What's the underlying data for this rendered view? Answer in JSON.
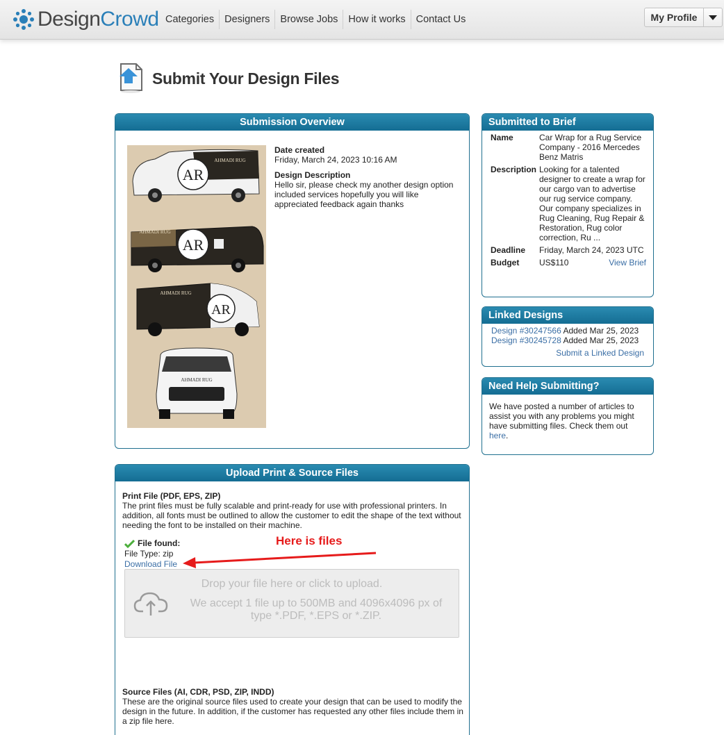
{
  "header": {
    "logo_design": "Design",
    "logo_crowd": "Crowd",
    "nav": [
      {
        "label": "Categories"
      },
      {
        "label": "Designers"
      },
      {
        "label": "Browse Jobs"
      },
      {
        "label": "How it works"
      },
      {
        "label": "Contact Us"
      }
    ],
    "profile_label": "My Profile"
  },
  "page": {
    "title": "Submit Your Design Files"
  },
  "overview": {
    "heading": "Submission Overview",
    "date_created_label": "Date created",
    "date_created_value": "Friday, March 24, 2023 10:16 AM",
    "description_label": "Design Description",
    "description_value": "Hello sir, please check my another design option included services hopefully you will like appreciated feedback again thanks",
    "van_brand": "AHMADI RUG"
  },
  "brief": {
    "heading": "Submitted to Brief",
    "name_label": "Name",
    "name_value": "Car Wrap for a Rug Service Company - 2016 Mercedes Benz Matris",
    "description_label": "Description",
    "description_value": "Looking for a talented designer to create a wrap for our cargo van to advertise our rug service company. Our company specializes in Rug Cleaning, Rug Repair & Restoration, Rug color correction, Ru ...",
    "deadline_label": "Deadline",
    "deadline_value": "Friday, March 24, 2023 UTC",
    "budget_label": "Budget",
    "budget_value": "US$110",
    "view_brief": "View Brief"
  },
  "linked": {
    "heading": "Linked Designs",
    "items": [
      {
        "link": "Design #30247566",
        "added": "Added Mar 25, 2023"
      },
      {
        "link": "Design #30245728",
        "added": "Added Mar 25, 2023"
      }
    ],
    "submit_link": "Submit a Linked Design"
  },
  "help": {
    "heading": "Need Help Submitting?",
    "text": "We have posted a number of articles to assist you with any problems you might have submitting files. Check them out",
    "link": "here",
    "period": "."
  },
  "upload": {
    "heading": "Upload Print & Source Files",
    "print_title": "Print File (PDF, EPS, ZIP)",
    "print_text": "The print files must be fully scalable and print-ready for use with professional printers. In addition, all fonts must be outlined to allow the customer to edit the shape of the text without needing the font to be installed on their machine.",
    "file_found": "File found:",
    "file_type": "File Type: zip",
    "download": "Download File",
    "annotation": "Here is files",
    "drop_line1": "Drop your file here or click to upload.",
    "drop_line2": "We accept 1 file up to 500MB and 4096x4096 px of type *.PDF, *.EPS or *.ZIP.",
    "source_title": "Source Files (AI, CDR, PSD, ZIP, INDD)",
    "source_text": "These are the original source files used to create your design that can be used to modify the design in the future. In addition, if the customer has requested any other files include them in a zip file here."
  },
  "colors": {
    "brand_blue": "#2a7fb8",
    "panel_head": "#146d93",
    "link": "#3a6ea5",
    "annotation_red": "#e61b1b"
  }
}
